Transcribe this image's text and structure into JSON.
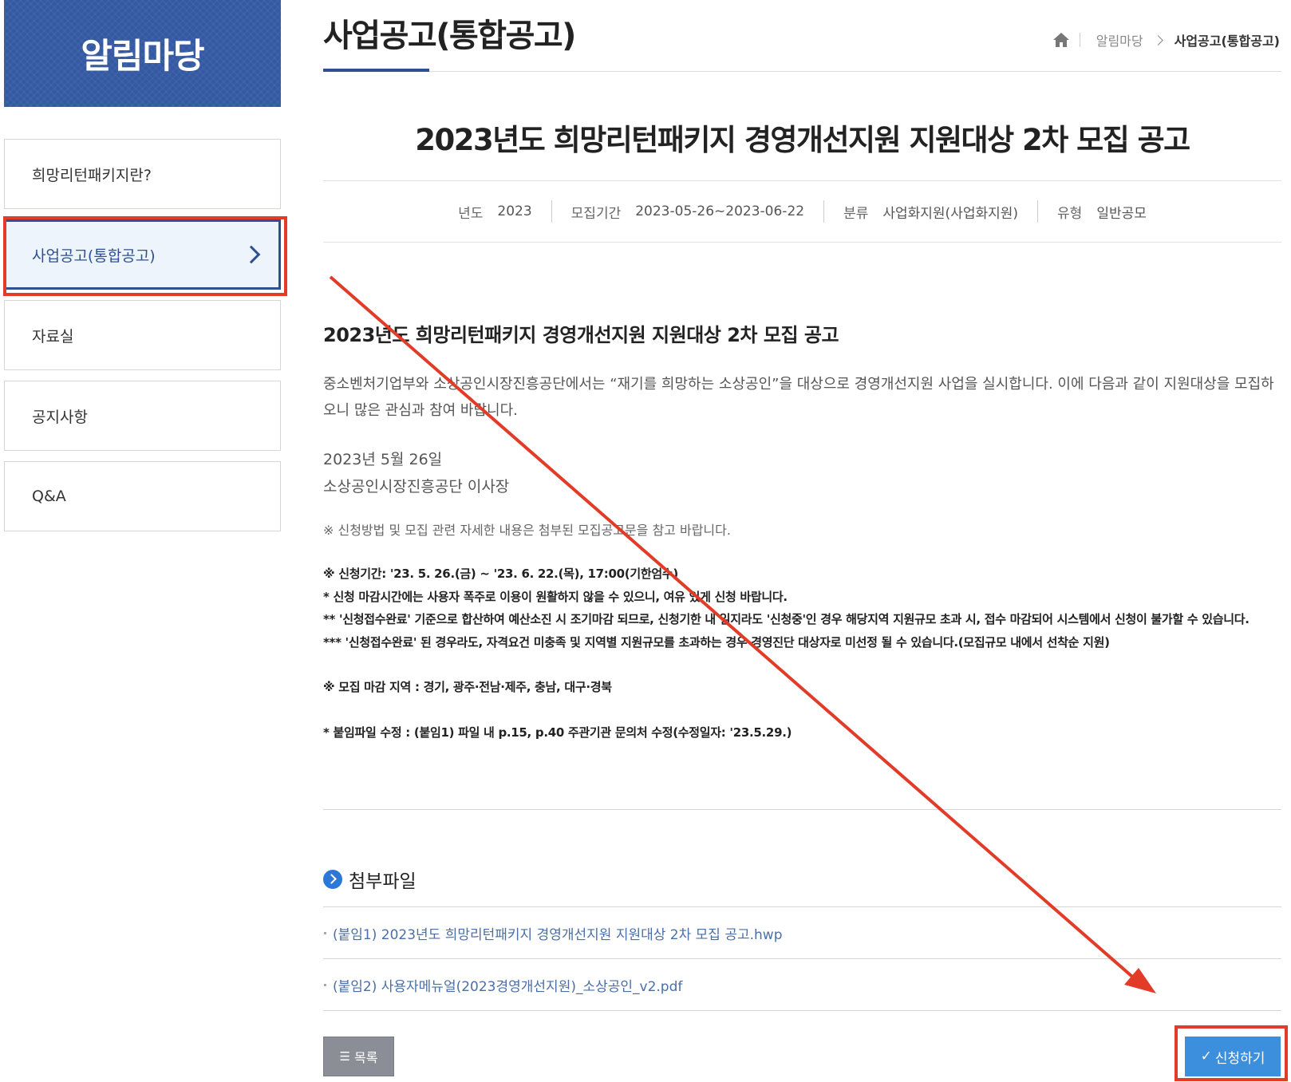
{
  "sidebar": {
    "banner_title": "알림마당",
    "items": [
      {
        "label": "희망리턴패키지란?"
      },
      {
        "label": "사업공고(통합공고)"
      },
      {
        "label": "자료실"
      },
      {
        "label": "공지사항"
      },
      {
        "label": "Q&A"
      }
    ],
    "active_index": 1
  },
  "header": {
    "page_title": "사업공고(통합공고)",
    "breadcrumb": {
      "home_icon": "home-icon",
      "parent": "알림마당",
      "current": "사업공고(통합공고)"
    }
  },
  "post": {
    "title": "2023년도 희망리턴패키지 경영개선지원 지원대상 2차 모집 공고",
    "meta": {
      "year_label": "년도",
      "year_value": "2023",
      "period_label": "모집기간",
      "period_value": "2023-05-26~2023-06-22",
      "category_label": "분류",
      "category_value": "사업화지원(사업화지원)",
      "type_label": "유형",
      "type_value": "일반공모"
    },
    "content": {
      "heading": "2023년도 희망리턴패키지 경영개선지원 지원대상 2차 모집 공고",
      "paragraph": "중소벤처기업부와 소상공인시장진흥공단에서는 “재기를 희망하는 소상공인”을 대상으로 경영개선지원 사업을 실시합니다. 이에 다음과 같이 지원대상을 모집하오니 많은 관심과 참여 바랍니다.",
      "date": "2023년 5월 26일",
      "signer": "소상공인시장진흥공단 이사장",
      "note": "※ 신청방법 및 모집 관련 자세한 내용은 첨부된 모집공고문을 참고 바랍니다.",
      "period_line": "※  신청기간: '23. 5. 26.(금) ~ '23. 6. 22.(목), 17:00(기한엄수)",
      "warn1": "* 신청 마감시간에는 사용자 폭주로 이용이 원활하지 않을 수 있으니, 여유 있게 신청 바랍니다.",
      "warn2": "** '신청접수완료' 기준으로 합산하여 예산소진 시 조기마감 되므로, 신청기한 내 일지라도 '신청중'인 경우 해당지역 지원규모 초과 시, 접수 마감되어 시스템에서 신청이 불가할 수 있습니다.",
      "warn3": "*** '신청접수완료' 된 경우라도, 자격요건 미충족 및 지역별 지원규모를 초과하는 경우 경영진단 대상자로 미선정 될 수 있습니다.(모집규모 내에서 선착순 지원)",
      "closed_regions": "※  모집 마감 지역 : 경기, 광주·전남·제주, 충남, 대구·경북",
      "file_fix": "* 붙임파일 수정 : (붙임1) 파일 내 p.15, p.40 주관기관 문의처 수정(수정일자: '23.5.29.)"
    }
  },
  "attachments": {
    "title": "첨부파일",
    "files": [
      {
        "name": "(붙임1) 2023년도 희망리턴패키지 경영개선지원 지원대상 2차 모집 공고.hwp"
      },
      {
        "name": "(붙임2) 사용자메뉴얼(2023경영개선지원)_소상공인_v2.pdf"
      }
    ]
  },
  "buttons": {
    "list_label": "목록",
    "list_icon": "list-icon",
    "apply_label": "신청하기",
    "apply_icon": "check-icon"
  },
  "colors": {
    "brand_blue": "#2f4f93",
    "apply_blue": "#3c8fdc",
    "annotation_red": "#e23b27"
  }
}
